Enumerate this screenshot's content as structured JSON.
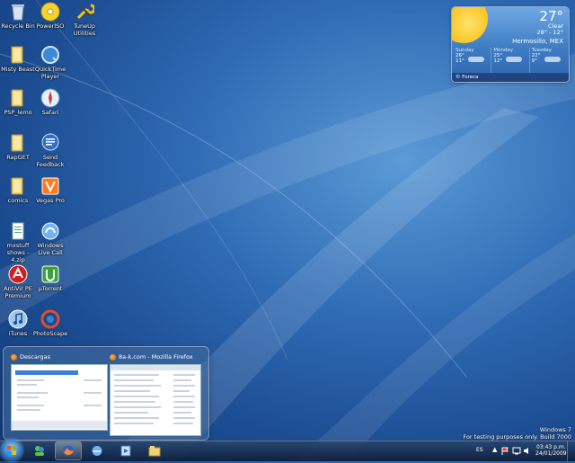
{
  "desktop_icons": [
    {
      "label": "Recycle Bin",
      "icon": "recycle-bin-icon"
    },
    {
      "label": "PowerISO",
      "icon": "poweriso-icon"
    },
    {
      "label": "TuneUp Utilities",
      "icon": "tuneup-icon"
    },
    {
      "label": "Misty Beast",
      "icon": "folder-icon"
    },
    {
      "label": "QuickTime Player",
      "icon": "quicktime-icon"
    },
    {
      "label": "PSP_lemo",
      "icon": "folder-icon"
    },
    {
      "label": "Safari",
      "icon": "safari-icon"
    },
    {
      "label": "RapGET",
      "icon": "folder-icon"
    },
    {
      "label": "Send Feedback",
      "icon": "feedback-icon"
    },
    {
      "label": "comics",
      "icon": "folder-icon"
    },
    {
      "label": "Vegas Pro",
      "icon": "vegas-icon"
    },
    {
      "label": "mxstuff shows - 4.zip",
      "icon": "document-icon"
    },
    {
      "label": "Windows Live Call",
      "icon": "live-call-icon"
    },
    {
      "label": "AntiVir PE Premium",
      "icon": "antivir-icon"
    },
    {
      "label": "µTorrent",
      "icon": "utorrent-icon"
    },
    {
      "label": "iTunes",
      "icon": "itunes-icon"
    },
    {
      "label": "PhotoScape",
      "icon": "photoscape-icon"
    }
  ],
  "weather": {
    "temperature": "27°",
    "condition": "Clear",
    "range": "28° - 12°",
    "city": "Hermosillo, MEX",
    "forecast": [
      {
        "day": "Sunday",
        "high": "26°",
        "low": "11°"
      },
      {
        "day": "Monday",
        "high": "25°",
        "low": "12°"
      },
      {
        "day": "Tuesday",
        "high": "22°",
        "low": "9°"
      }
    ],
    "footer": "© Foreca"
  },
  "preview": {
    "windows": [
      {
        "title": "Descargas"
      },
      {
        "title": "8a-k.com - Mozilla Firefox"
      }
    ]
  },
  "taskbar": {
    "buttons": [
      {
        "name": "messenger",
        "icon": "messenger-icon",
        "active": false
      },
      {
        "name": "firefox",
        "icon": "firefox-icon",
        "active": true
      },
      {
        "name": "ie",
        "icon": "internet-explorer-icon",
        "active": false
      },
      {
        "name": "media",
        "icon": "media-player-icon",
        "active": false
      },
      {
        "name": "explorer",
        "icon": "explorer-icon",
        "active": false
      }
    ],
    "language": "ES",
    "time": "03:43 p.m.",
    "date": "24/01/2009"
  },
  "watermark": {
    "line1": "Windows 7",
    "line2": "For testing purposes only. Build 7000"
  }
}
